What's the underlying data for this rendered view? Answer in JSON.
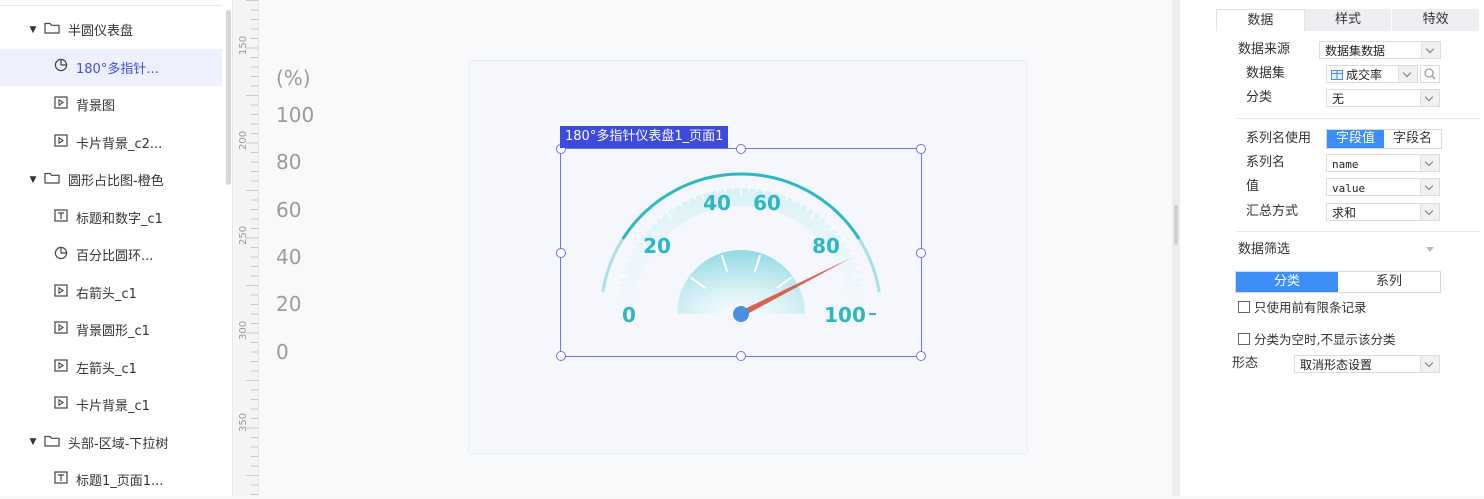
{
  "tree": {
    "items": [
      {
        "label": "半圆仪表盘",
        "icon": "folder-icon",
        "level": 0,
        "expanded": true
      },
      {
        "label": "180°多指针...",
        "icon": "pie-chart-icon",
        "level": 1,
        "selected": true
      },
      {
        "label": "背景图",
        "icon": "play-box-icon",
        "level": 1
      },
      {
        "label": "卡片背景_c2...",
        "icon": "play-box-icon",
        "level": 1
      },
      {
        "label": "圆形占比图-橙色",
        "icon": "folder-icon",
        "level": 0,
        "expanded": true
      },
      {
        "label": "标题和数字_c1",
        "icon": "text-box-icon",
        "level": 1
      },
      {
        "label": "百分比圆环...",
        "icon": "pie-chart-icon",
        "level": 1
      },
      {
        "label": "右箭头_c1",
        "icon": "play-box-icon",
        "level": 1
      },
      {
        "label": "背景圆形_c1",
        "icon": "play-box-icon",
        "level": 1
      },
      {
        "label": "左箭头_c1",
        "icon": "play-box-icon",
        "level": 1
      },
      {
        "label": "卡片背景_c1",
        "icon": "play-box-icon",
        "level": 1
      },
      {
        "label": "头部-区域-下拉树",
        "icon": "folder-icon",
        "level": 0,
        "expanded": true
      },
      {
        "label": "标题1_页面1...",
        "icon": "text-box-icon",
        "level": 1
      }
    ]
  },
  "ruler": {
    "marks": [
      "150",
      "200",
      "250",
      "300",
      "350"
    ]
  },
  "canvas": {
    "unit_label": "(%)",
    "y_labels": [
      "100",
      "80",
      "60",
      "40",
      "20",
      "0"
    ],
    "selection_label": "180°多指针仪表盘1_页面1"
  },
  "gauge": {
    "ticks": [
      "0",
      "20",
      "40",
      "60",
      "80",
      "100"
    ],
    "pointer_value": 85,
    "min": 0,
    "max": 100,
    "arc_color": "#2bb7c4",
    "pointer_color": "#d9614f",
    "pivot_color": "#4a90e2"
  },
  "panel": {
    "tabs": [
      {
        "label": "数据",
        "active": true
      },
      {
        "label": "样式",
        "active": false
      },
      {
        "label": "特效",
        "active": false
      }
    ],
    "data_source_label": "数据来源",
    "data_source_value": "数据集数据",
    "dataset_label": "数据集",
    "dataset_value": "成交率",
    "category_label": "分类",
    "category_value": "无",
    "series_name_use_label": "系列名使用",
    "series_name_options": [
      "字段值",
      "字段名"
    ],
    "series_name_label": "系列名",
    "series_name_value": "name",
    "value_label": "值",
    "value_value": "value",
    "aggregate_label": "汇总方式",
    "aggregate_value": "求和",
    "filter_label": "数据筛选",
    "filter_tabs": [
      "分类",
      "系列"
    ],
    "only_first_records": "只使用前有限条记录",
    "hide_empty_category": "分类为空时,不显示该分类",
    "form_label": "形态",
    "form_value": "取消形态设置"
  }
}
